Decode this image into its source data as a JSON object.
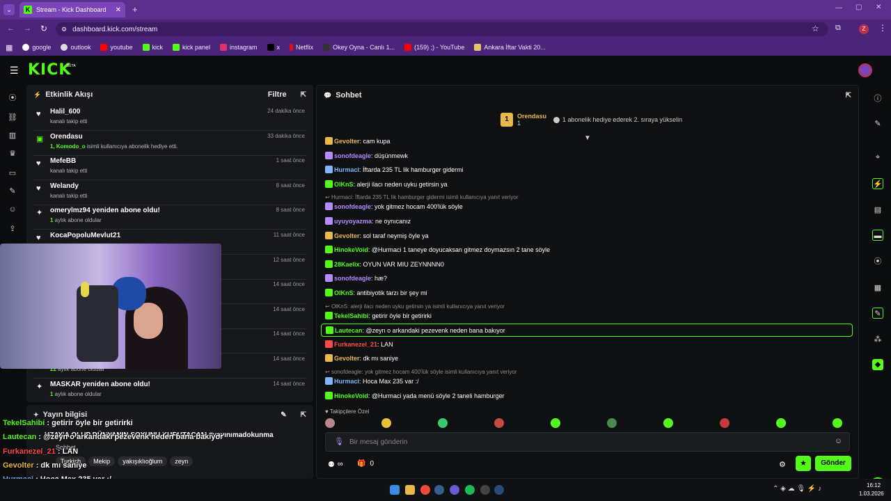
{
  "browser": {
    "tab_title": "Stream - Kick Dashboard",
    "url": "dashboard.kick.com/stream",
    "profile_initial": "Z",
    "bookmarks": [
      "google",
      "outlook",
      "youtube",
      "kick",
      "kick panel",
      "instagram",
      "x",
      "Netflix",
      "Okey Oyna - Canlı 1...",
      "(159) ;) - YouTube",
      "Ankara İftar Vakti 20..."
    ]
  },
  "app": {
    "logo": "KICK",
    "beta": "BETA"
  },
  "activity": {
    "title": "Etkinlik Akışı",
    "filter": "Filtre",
    "items": [
      {
        "title": "Halil_600",
        "sub": "kanalı takip etti",
        "time": "24 dakika önce",
        "icon": "heart-icon"
      },
      {
        "title": "Orendasu",
        "sub_green": "1, Komodo_o",
        "sub": " isimli kullanıcıya abonelik hediye etti.",
        "time": "33 dakika önce",
        "icon": "gift-icon"
      },
      {
        "title": "MefeBB",
        "sub": "kanalı takip etti",
        "time": "1 saat önce",
        "icon": "heart-icon"
      },
      {
        "title": "Welandy",
        "sub": "kanalı takip etti",
        "time": "8 saat önce",
        "icon": "heart-icon"
      },
      {
        "title": "omerylmz94 yeniden abone oldu!",
        "sub_green": "1",
        "sub": " aylık abone oldular",
        "time": "8 saat önce",
        "icon": "sparkle-icon"
      },
      {
        "title": "KocaPopoluMevlut21",
        "sub": "",
        "time": "11 saat önce",
        "icon": "heart-icon"
      },
      {
        "title": "",
        "sub": "",
        "time": "12 saat önce",
        "icon": "heart-icon"
      },
      {
        "title": "",
        "sub": "",
        "time": "14 saat önce",
        "icon": "heart-icon"
      },
      {
        "title": "",
        "sub": "",
        "time": "14 saat önce",
        "icon": "heart-icon"
      },
      {
        "title": "",
        "sub": "",
        "time": "14 saat önce",
        "icon": "heart-icon"
      },
      {
        "title": "",
        "sub_green": "22",
        "sub": " aylık abone oldular",
        "time": "14 saat önce",
        "icon": "sparkle-icon"
      },
      {
        "title": "MASKAR yeniden abone oldu!",
        "sub_green": "1",
        "sub": " aylık abone oldular",
        "time": "14 saat önce",
        "icon": "sparkle-icon"
      }
    ]
  },
  "stream_info": {
    "title": "Yayın bilgisi",
    "stream_title": "UZAY'A OLUP DÜNYANIN SOYUNU KURUTACAM #yayınımadokunma",
    "category": "Sohbet",
    "tags": [
      "Turkish",
      "Mekip",
      "yakışıklıoğlum",
      "zeyn"
    ]
  },
  "chat": {
    "title": "Sohbet",
    "top_gifter": {
      "rank": "1",
      "name": "Orendasu",
      "count": "1"
    },
    "gift_prompt": "1 abonelik hediye ederek 2. sıraya yükselin",
    "messages": [
      {
        "user": "Gevolter",
        "text": "cam kupa",
        "color": "#e8b84a"
      },
      {
        "user": "sonofdeagle",
        "text": "düşünmewk",
        "color": "#b58cff"
      },
      {
        "user": "Hurmaci",
        "text": "İftarda 235 TL lik hamburger gidermi",
        "color": "#7fb6ff"
      },
      {
        "user": "OlKnS",
        "text": "alerji ilacı neden uyku getirsin ya",
        "color": "#53fc18"
      },
      {
        "reply": "Hurmaci: İftarda 235 TL lik hamburger gidermi isimli kullanıcıya yanıt veriyor"
      },
      {
        "user": "sonofdeagle",
        "text": "yok gitmez hocam 400'lük söyle",
        "color": "#b58cff"
      },
      {
        "user": "uyuyoyazma",
        "text": "ne oynıcanız",
        "color": "#b58cff"
      },
      {
        "user": "Gevolter",
        "text": "sol taraf neymiş öyle ya",
        "color": "#e8b84a"
      },
      {
        "user": "HinokeVoid",
        "text": "@Hurmaci 1 taneye doyucaksan gitmez doymazsın 2 tane söyle",
        "color": "#53fc18"
      },
      {
        "user": "28Kaelix",
        "text": "OYUN VAR MIU ZEYNNNN0",
        "color": "#53fc18"
      },
      {
        "user": "sonofdeagle",
        "text": "hæ?",
        "color": "#b58cff"
      },
      {
        "user": "OlKnS",
        "text": "antibiyotik tarzı bir şey mi",
        "color": "#53fc18"
      },
      {
        "reply": "OlKnS: alerji ilacı neden uyku getirsin ya isimli kullanıcıya yanıt veriyor"
      },
      {
        "user": "TekelSahibi",
        "text": "getirir öyle bir getirirki",
        "color": "#53fc18"
      },
      {
        "user": "Lautecan",
        "text": "@zeyn o arkandaki pezevenk neden bana bakıyor",
        "color": "#53fc18",
        "highlight": true
      },
      {
        "user": "Furkanezel_21",
        "text": "LAN",
        "color": "#ff4a4a"
      },
      {
        "user": "Gevolter",
        "text": "dk mı saniye",
        "color": "#e8b84a"
      },
      {
        "reply": "sonofdeagle: yok gitmez hocam 400'lük söyle isimli kullanıcıya yanıt veriyor"
      },
      {
        "user": "Hurmaci",
        "text": "Hoca Max 235 var :/",
        "color": "#7fb6ff"
      },
      {
        "user": "HinokeVoid",
        "text": "@Hurmaci yada menü söyle 2 taneli hamburger",
        "color": "#53fc18"
      }
    ],
    "followers_only": "Takipçilere Özel",
    "input_placeholder": "Bir mesaj gönderin",
    "points": "∞",
    "gift_count": "0",
    "send_label": "Gönder"
  },
  "overlay": {
    "lines": [
      {
        "user": "TekelSahibi",
        "text": " : getirir öyle bir getirirki",
        "color": "#53fc18"
      },
      {
        "user": "Lautecan",
        "text": " : @zeyn o arkandaki pezevenk neden bana bakıyor",
        "color": "#53fc18"
      },
      {
        "user": "Furkanezel_21",
        "text": " : LAN",
        "color": "#ff4a4a"
      },
      {
        "user": "Gevolter",
        "text": " : dk mı saniye",
        "color": "#e8b84a"
      },
      {
        "user": "Hurmaci",
        "text": " : Hoca Max 235 var :/",
        "color": "#7fb6ff"
      },
      {
        "user": "HinokeVoid",
        "text": " : @Hurmaci yada menü söyle 2 taneli hamburger",
        "color": "#53fc18"
      }
    ]
  },
  "taskbar": {
    "time": "16:12",
    "date": "1.03.2026"
  },
  "colors": {
    "accent": "#53fc18",
    "browser": "#4a2579",
    "panel": "#16181b"
  }
}
